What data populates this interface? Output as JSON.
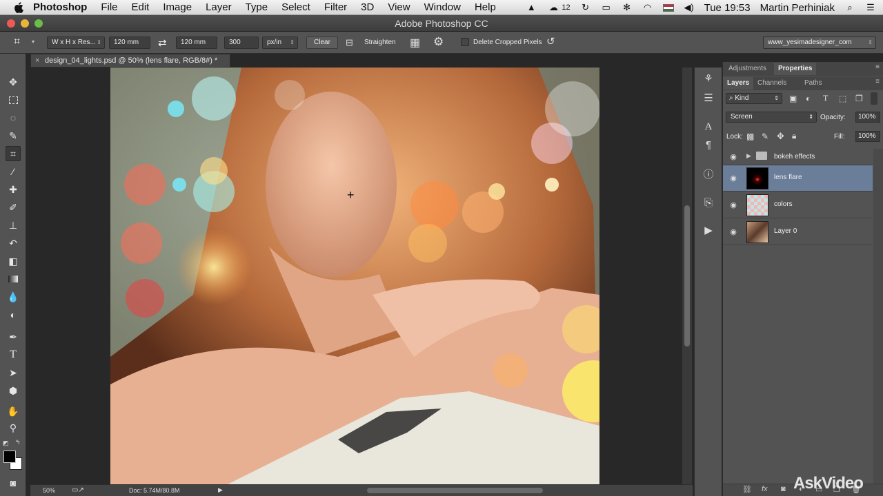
{
  "menubar": {
    "app": "Photoshop",
    "items": [
      "File",
      "Edit",
      "Image",
      "Layer",
      "Type",
      "Select",
      "Filter",
      "3D",
      "View",
      "Window",
      "Help"
    ],
    "badge": "12",
    "clock": "Tue 19:53",
    "user": "Martin Perhiniak"
  },
  "window": {
    "title": "Adobe Photoshop CC"
  },
  "options": {
    "ratio_select": "W x H x Res...",
    "width": "120 mm",
    "height": "120 mm",
    "resolution": "300",
    "res_unit": "px/in",
    "clear": "Clear",
    "straighten": "Straighten",
    "delete_cropped": "Delete Cropped Pixels",
    "workspace": "www_yesimadesigner_com"
  },
  "document": {
    "tab": "design_04_lights.psd @ 50% (lens flare, RGB/8#) *",
    "close": "×"
  },
  "status": {
    "zoom": "50%",
    "doc": "Doc: 5.74M/80.8M"
  },
  "panels": {
    "top_tabs": [
      "Adjustments",
      "Properties"
    ],
    "tabs": [
      "Layers",
      "Channels",
      "Paths"
    ],
    "filter": "Kind",
    "blend_mode": "Screen",
    "opacity_label": "Opacity:",
    "opacity": "100%",
    "lock_label": "Lock:",
    "fill_label": "Fill:",
    "fill": "100%",
    "layers": [
      {
        "name": "bokeh effects",
        "type": "group"
      },
      {
        "name": "lens flare",
        "type": "layer",
        "selected": true
      },
      {
        "name": "colors",
        "type": "layer"
      },
      {
        "name": "Layer 0",
        "type": "layer"
      }
    ]
  },
  "watermark": "AskVideo",
  "colors": {
    "selected_layer": "#6a7d99",
    "panel": "#535353"
  }
}
